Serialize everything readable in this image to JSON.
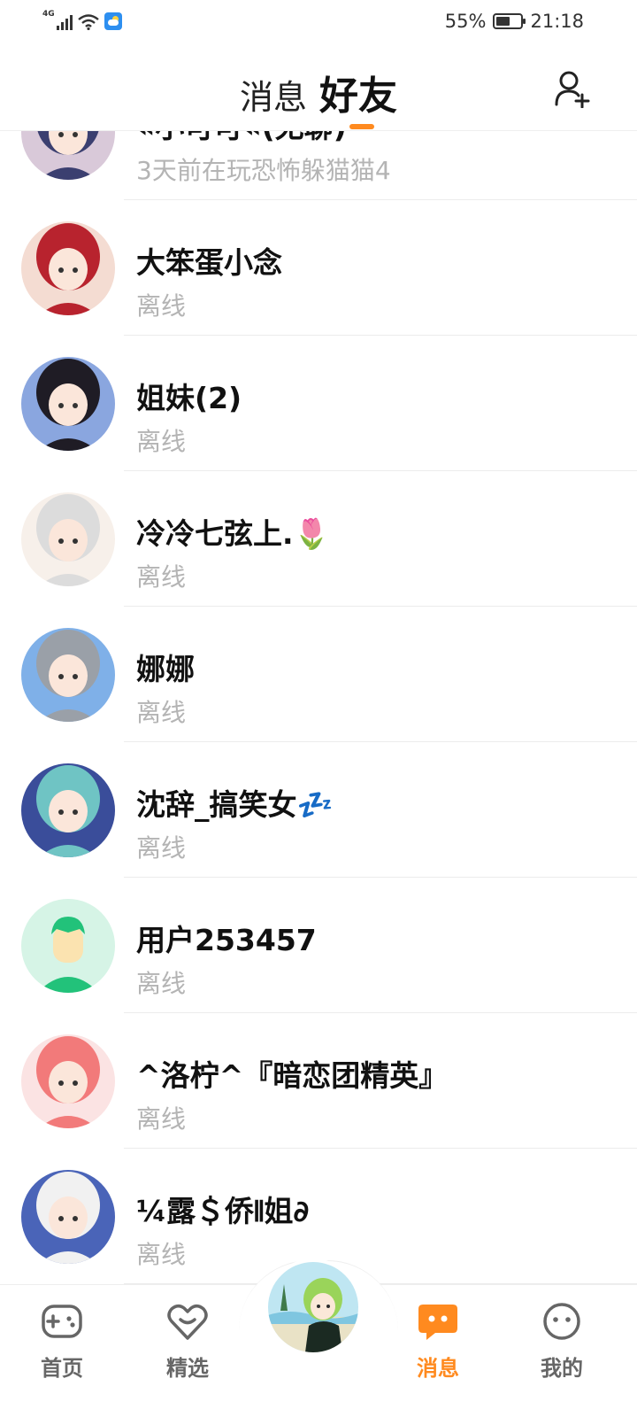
{
  "status_bar": {
    "signal_type": "4G",
    "battery_percent_text": "55%",
    "battery_level": 0.55,
    "time": "21:18"
  },
  "header": {
    "tab_messages": "消息",
    "tab_friends": "好友",
    "active_tab": "friends",
    "accent_color": "#ff8a1f"
  },
  "friends": [
    {
      "name": "«小可可«(无聊)",
      "status": "3天前在玩恐怖躲猫猫4",
      "avatar_colors": [
        "#3b3f70",
        "#d9c9d9"
      ]
    },
    {
      "name": "大笨蛋小念",
      "status": "离线",
      "avatar_colors": [
        "#b8232e",
        "#f4dcd2"
      ]
    },
    {
      "name": "姐妹(2)",
      "status": "离线",
      "avatar_colors": [
        "#1f1c25",
        "#8aa6df"
      ]
    },
    {
      "name": "冷冷七弦上.🌷",
      "status": "离线",
      "avatar_colors": [
        "#dcdcdc",
        "#f7f0ea"
      ]
    },
    {
      "name": "娜娜",
      "status": "离线",
      "avatar_colors": [
        "#9aa0a8",
        "#7fb0e8"
      ]
    },
    {
      "name": "沈辞_搞笑女💤",
      "status": "离线",
      "avatar_colors": [
        "#6fc4c4",
        "#3a4d9a"
      ]
    },
    {
      "name": "用户253457",
      "status": "离线",
      "avatar_colors": [
        "#22c27a",
        "#d6f4e6"
      ]
    },
    {
      "name": "^洛柠^『暗恋团精英』",
      "status": "离线",
      "avatar_colors": [
        "#f27a7a",
        "#fbe3e3"
      ]
    },
    {
      "name": "¼露＄侨𝍪姐∂",
      "status": "离线",
      "avatar_colors": [
        "#f1f1f1",
        "#4a64b8"
      ]
    }
  ],
  "bottom_nav": {
    "items": [
      {
        "label": "首页",
        "icon": "gamepad-icon"
      },
      {
        "label": "精选",
        "icon": "heart-icon"
      },
      {
        "label": "消息",
        "icon": "chat-bubble-icon",
        "active": true
      },
      {
        "label": "我的",
        "icon": "smiley-face-icon"
      }
    ],
    "center_icon": "center-avatar-button"
  }
}
